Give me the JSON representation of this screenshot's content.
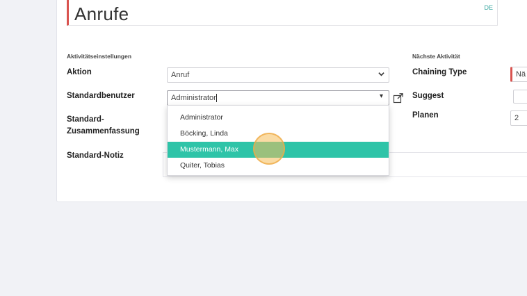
{
  "header": {
    "title": "Anrufe",
    "lang": "DE"
  },
  "sections": {
    "activity_settings": "Aktivitätseinstellungen",
    "next_activity": "Nächste Aktivität"
  },
  "fields": {
    "aktion": {
      "label": "Aktion",
      "value": "Anruf"
    },
    "standardbenutzer": {
      "label": "Standardbenutzer",
      "value": "Administrator"
    },
    "zusammenfassung": {
      "label_line1": "Standard-",
      "label_line2": "Zusammenfassung"
    },
    "notiz": {
      "label": "Standard-Notiz"
    },
    "chaining_type": {
      "label": "Chaining Type",
      "value": "Nä"
    },
    "suggest": {
      "label": "Suggest"
    },
    "planen": {
      "label": "Planen",
      "value": "2"
    }
  },
  "dropdown": {
    "options": [
      "Administrator",
      "Böcking, Linda",
      "Mustermann, Max",
      "Quiter, Tobias"
    ],
    "active_index": 2
  },
  "icons": {
    "select_arrow": "chevron-down-icon",
    "external_link": "external-link-icon"
  },
  "colors": {
    "accent": "#2ec4a8",
    "required": "#d9534f",
    "lang": "#3aa7a0",
    "cursor": "#f6be5a"
  }
}
